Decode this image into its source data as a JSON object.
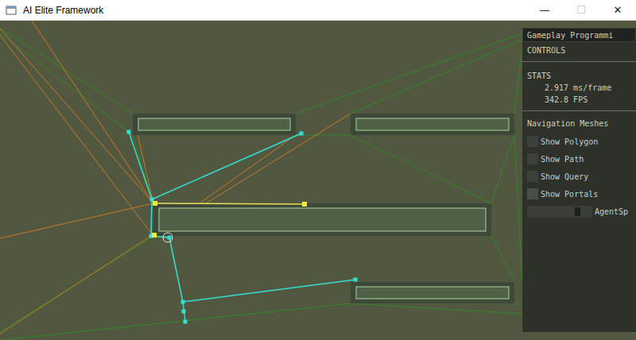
{
  "window": {
    "title": "AI Elite Framework",
    "controls": [
      {
        "label": "—",
        "disabled": false
      },
      {
        "label": "☐",
        "disabled": true
      },
      {
        "label": "✕",
        "disabled": false
      }
    ]
  },
  "panel": {
    "title": "Gameplay Programmi",
    "controls_label": "CONTROLS",
    "stats": {
      "label": "STATS",
      "lines": [
        "2.917 ms/frame",
        "342.8 FPS"
      ]
    },
    "navmesh": {
      "label": "Navigation Meshes",
      "options": [
        {
          "kind": "checkbox",
          "label": "Show Polygon",
          "checked": false,
          "hovered": false
        },
        {
          "kind": "checkbox",
          "label": "Show Path",
          "checked": false,
          "hovered": false
        },
        {
          "kind": "checkbox",
          "label": "Show Query",
          "checked": false,
          "hovered": false
        },
        {
          "kind": "checkbox",
          "label": "Show Portals",
          "checked": false,
          "hovered": true
        },
        {
          "kind": "slider",
          "label": "AgentSp",
          "level": 0.8
        }
      ]
    }
  }
}
